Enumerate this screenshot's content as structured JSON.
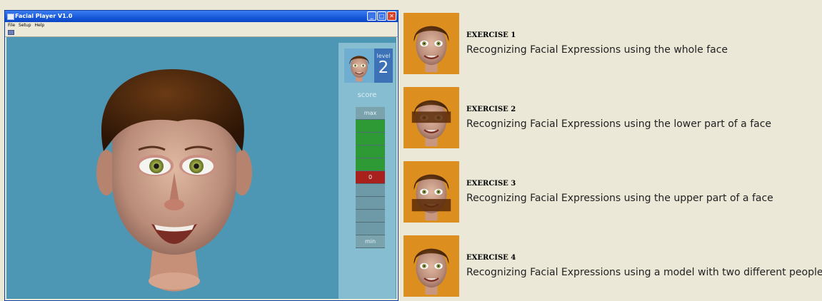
{
  "window": {
    "title": "Facial Player V1.0",
    "controls": {
      "minimize": "_",
      "maximize": "□",
      "close": "✕"
    }
  },
  "menu": {
    "items": [
      "File",
      "Setup",
      "Help"
    ]
  },
  "colors": {
    "stage": "#4d97b5",
    "panel": "#86bdd0",
    "meter_filled": "#2d9a36",
    "meter_zero": "#a8211c",
    "meter_empty": "#6d9aa6",
    "exercise_icon_bg": "#dc8e1e"
  },
  "game": {
    "level_label": "level",
    "level_value": "2",
    "score_label": "score",
    "meter": {
      "max_label": "max",
      "zero_label": "0",
      "min_label": "min",
      "filled_segments": 4,
      "empty_segments": 4
    }
  },
  "exercises": [
    {
      "title": "EXERCISE 1",
      "description": "Recognizing Facial Expressions using the whole face",
      "icon": "face-full-icon"
    },
    {
      "title": "EXERCISE 2",
      "description": "Recognizing Facial Expressions using the lower part of a face",
      "icon": "face-upper-masked-icon"
    },
    {
      "title": "EXERCISE 3",
      "description": "Recognizing Facial Expressions using the upper part of a face",
      "icon": "face-lower-masked-icon"
    },
    {
      "title": "EXERCISE 4",
      "description": "Recognizing Facial Expressions using a model with two different people",
      "icon": "face-full-icon"
    }
  ]
}
